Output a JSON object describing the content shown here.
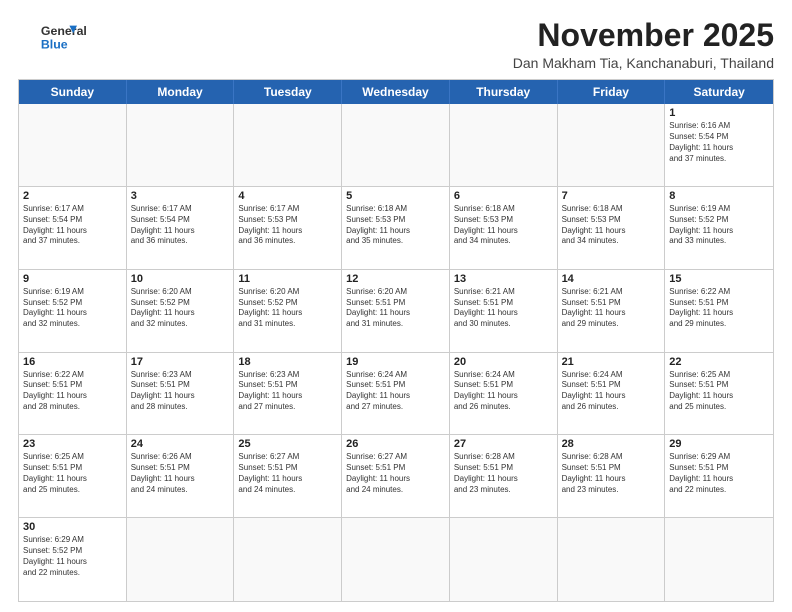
{
  "logo": {
    "line1": "General",
    "line2": "Blue"
  },
  "header": {
    "month_title": "November 2025",
    "subtitle": "Dan Makham Tia, Kanchanaburi, Thailand"
  },
  "days": [
    "Sunday",
    "Monday",
    "Tuesday",
    "Wednesday",
    "Thursday",
    "Friday",
    "Saturday"
  ],
  "weeks": [
    [
      {
        "day": "",
        "info": ""
      },
      {
        "day": "",
        "info": ""
      },
      {
        "day": "",
        "info": ""
      },
      {
        "day": "",
        "info": ""
      },
      {
        "day": "",
        "info": ""
      },
      {
        "day": "",
        "info": ""
      },
      {
        "day": "1",
        "info": "Sunrise: 6:16 AM\nSunset: 5:54 PM\nDaylight: 11 hours\nand 37 minutes."
      }
    ],
    [
      {
        "day": "2",
        "info": "Sunrise: 6:17 AM\nSunset: 5:54 PM\nDaylight: 11 hours\nand 37 minutes."
      },
      {
        "day": "3",
        "info": "Sunrise: 6:17 AM\nSunset: 5:54 PM\nDaylight: 11 hours\nand 36 minutes."
      },
      {
        "day": "4",
        "info": "Sunrise: 6:17 AM\nSunset: 5:53 PM\nDaylight: 11 hours\nand 36 minutes."
      },
      {
        "day": "5",
        "info": "Sunrise: 6:18 AM\nSunset: 5:53 PM\nDaylight: 11 hours\nand 35 minutes."
      },
      {
        "day": "6",
        "info": "Sunrise: 6:18 AM\nSunset: 5:53 PM\nDaylight: 11 hours\nand 34 minutes."
      },
      {
        "day": "7",
        "info": "Sunrise: 6:18 AM\nSunset: 5:53 PM\nDaylight: 11 hours\nand 34 minutes."
      },
      {
        "day": "8",
        "info": "Sunrise: 6:19 AM\nSunset: 5:52 PM\nDaylight: 11 hours\nand 33 minutes."
      }
    ],
    [
      {
        "day": "9",
        "info": "Sunrise: 6:19 AM\nSunset: 5:52 PM\nDaylight: 11 hours\nand 32 minutes."
      },
      {
        "day": "10",
        "info": "Sunrise: 6:20 AM\nSunset: 5:52 PM\nDaylight: 11 hours\nand 32 minutes."
      },
      {
        "day": "11",
        "info": "Sunrise: 6:20 AM\nSunset: 5:52 PM\nDaylight: 11 hours\nand 31 minutes."
      },
      {
        "day": "12",
        "info": "Sunrise: 6:20 AM\nSunset: 5:51 PM\nDaylight: 11 hours\nand 31 minutes."
      },
      {
        "day": "13",
        "info": "Sunrise: 6:21 AM\nSunset: 5:51 PM\nDaylight: 11 hours\nand 30 minutes."
      },
      {
        "day": "14",
        "info": "Sunrise: 6:21 AM\nSunset: 5:51 PM\nDaylight: 11 hours\nand 29 minutes."
      },
      {
        "day": "15",
        "info": "Sunrise: 6:22 AM\nSunset: 5:51 PM\nDaylight: 11 hours\nand 29 minutes."
      }
    ],
    [
      {
        "day": "16",
        "info": "Sunrise: 6:22 AM\nSunset: 5:51 PM\nDaylight: 11 hours\nand 28 minutes."
      },
      {
        "day": "17",
        "info": "Sunrise: 6:23 AM\nSunset: 5:51 PM\nDaylight: 11 hours\nand 28 minutes."
      },
      {
        "day": "18",
        "info": "Sunrise: 6:23 AM\nSunset: 5:51 PM\nDaylight: 11 hours\nand 27 minutes."
      },
      {
        "day": "19",
        "info": "Sunrise: 6:24 AM\nSunset: 5:51 PM\nDaylight: 11 hours\nand 27 minutes."
      },
      {
        "day": "20",
        "info": "Sunrise: 6:24 AM\nSunset: 5:51 PM\nDaylight: 11 hours\nand 26 minutes."
      },
      {
        "day": "21",
        "info": "Sunrise: 6:24 AM\nSunset: 5:51 PM\nDaylight: 11 hours\nand 26 minutes."
      },
      {
        "day": "22",
        "info": "Sunrise: 6:25 AM\nSunset: 5:51 PM\nDaylight: 11 hours\nand 25 minutes."
      }
    ],
    [
      {
        "day": "23",
        "info": "Sunrise: 6:25 AM\nSunset: 5:51 PM\nDaylight: 11 hours\nand 25 minutes."
      },
      {
        "day": "24",
        "info": "Sunrise: 6:26 AM\nSunset: 5:51 PM\nDaylight: 11 hours\nand 24 minutes."
      },
      {
        "day": "25",
        "info": "Sunrise: 6:27 AM\nSunset: 5:51 PM\nDaylight: 11 hours\nand 24 minutes."
      },
      {
        "day": "26",
        "info": "Sunrise: 6:27 AM\nSunset: 5:51 PM\nDaylight: 11 hours\nand 24 minutes."
      },
      {
        "day": "27",
        "info": "Sunrise: 6:28 AM\nSunset: 5:51 PM\nDaylight: 11 hours\nand 23 minutes."
      },
      {
        "day": "28",
        "info": "Sunrise: 6:28 AM\nSunset: 5:51 PM\nDaylight: 11 hours\nand 23 minutes."
      },
      {
        "day": "29",
        "info": "Sunrise: 6:29 AM\nSunset: 5:51 PM\nDaylight: 11 hours\nand 22 minutes."
      }
    ],
    [
      {
        "day": "30",
        "info": "Sunrise: 6:29 AM\nSunset: 5:52 PM\nDaylight: 11 hours\nand 22 minutes."
      },
      {
        "day": "",
        "info": ""
      },
      {
        "day": "",
        "info": ""
      },
      {
        "day": "",
        "info": ""
      },
      {
        "day": "",
        "info": ""
      },
      {
        "day": "",
        "info": ""
      },
      {
        "day": "",
        "info": ""
      }
    ]
  ]
}
